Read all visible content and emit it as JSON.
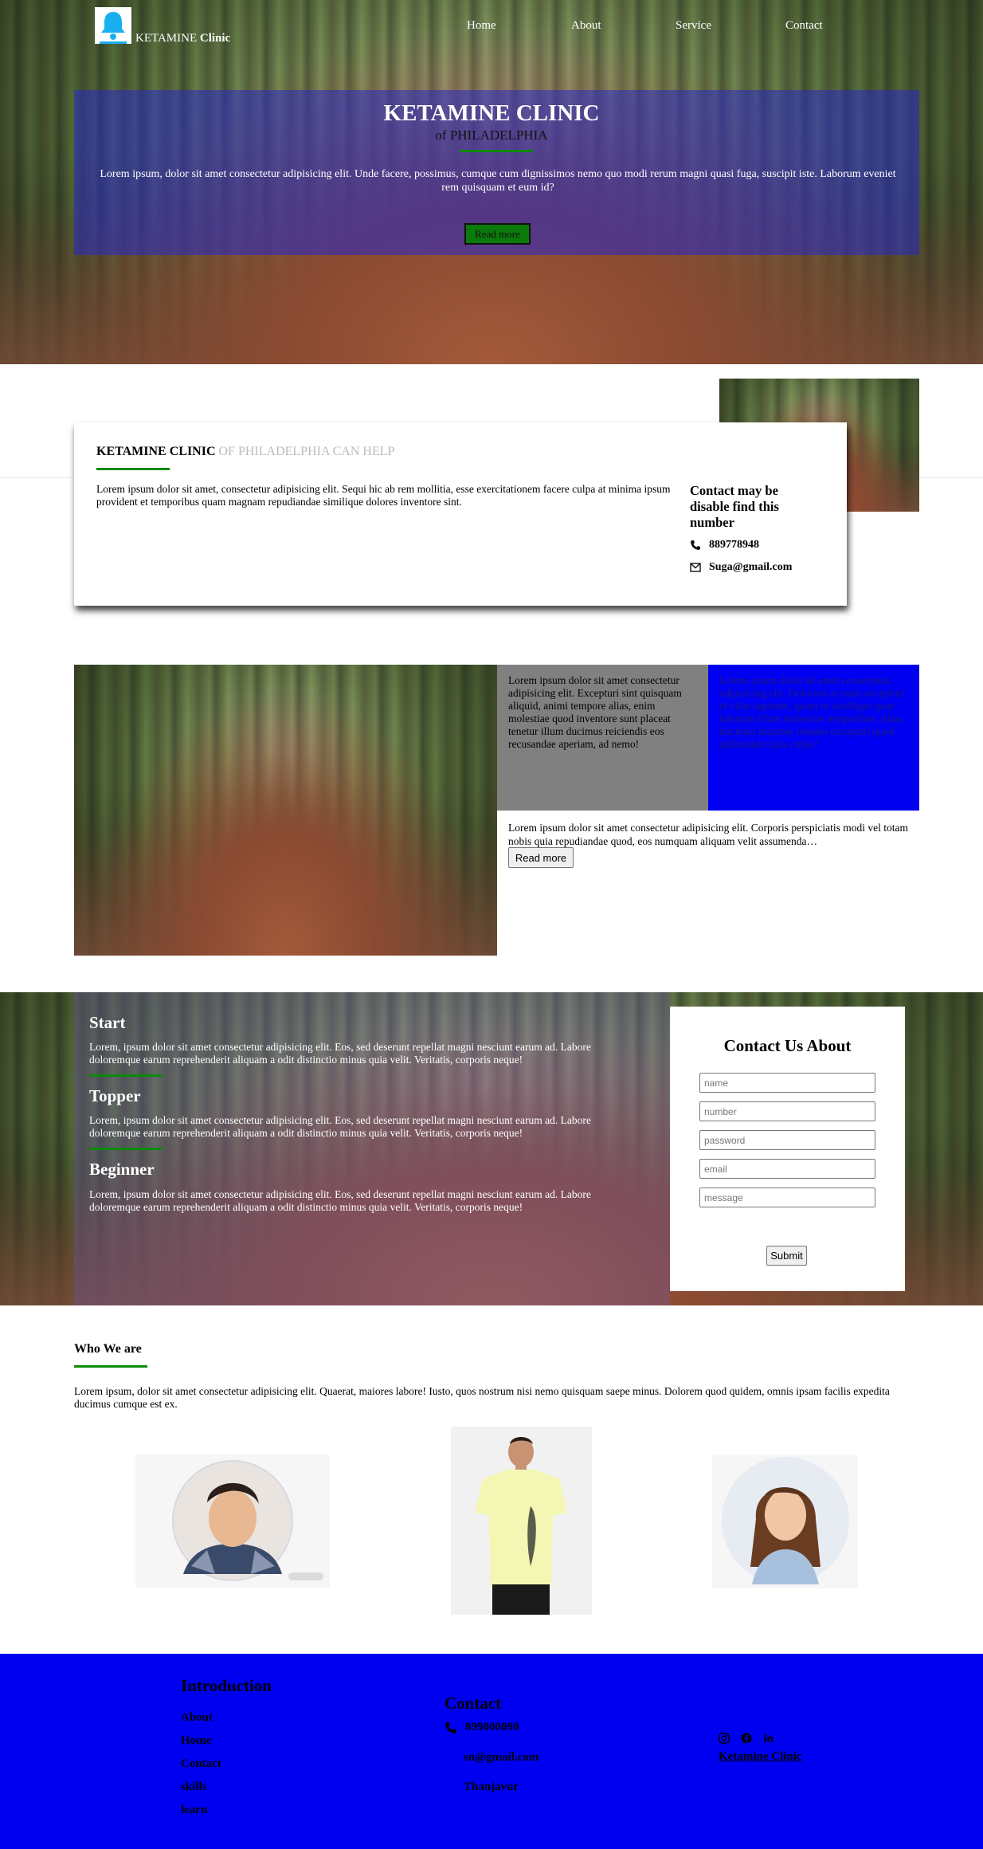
{
  "header": {
    "brand_main": "KETAMINE",
    "brand_bold": "Clinic",
    "nav": [
      "Home",
      "About",
      "Service",
      "Contact"
    ]
  },
  "hero": {
    "title": "KETAMINE CLINIC",
    "subtitle": "of PHILADELPHIA",
    "text": "Lorem ipsum, dolor sit amet consectetur adipisicing elit. Unde facere, possimus, cumque cum dignissimos nemo quo modi rerum magni quasi fuga, suscipit iste. Laborum eveniet rem quisquam et eum id?",
    "button": "Read more"
  },
  "card": {
    "title_bold": "KETAMINE CLINIC",
    "title_light": " OF PHILADELPHIA CAN HELP",
    "text": "Lorem ipsum dolor sit amet, consectetur adipisicing elit. Sequi hic ab rem mollitia, esse exercitationem facere culpa at minima ipsum provident et temporibus quam magnam repudiandae similique dolores inventore sint.",
    "contact_heading": "Contact may be disable find this number",
    "phone": "889778948",
    "email": "Suga@gmail.com"
  },
  "feature": {
    "gray_text": "Lorem ipsum dolor sit amet consectetur adipisicing elit. Excepturi sint quisquam aliquid, animi tempore alias, enim molestiae quod inventore sunt placeat tenetur illum ducimus reiciendis eos recusandae aperiam, ad nemo!",
    "blue_text": "Lorem ipsum dolor sit amet consectetur adipisicing elit. Dolorum at enim excepturi et vitae sapiente, quam ut similique quae laborum illum molestiae temporibus. Alias ducimus maxime veniam excepturi quod quibusdam quia culpa?",
    "text": "Lorem ipsum dolor sit amet consectetur adipisicing elit. Corporis perspiciatis modi vel totam nobis quia repudiandae quod, eos numquam aliquam velit assumenda…",
    "button": "Read more"
  },
  "levels": [
    {
      "title": "Start",
      "text": "Lorem, ipsum dolor sit amet consectetur adipisicing elit. Eos, sed deserunt repellat magni nesciunt earum ad. Labore doloremque earum reprehenderit aliquam a odit distinctio minus quia velit. Veritatis, corporis neque!"
    },
    {
      "title": "Topper",
      "text": "Lorem, ipsum dolor sit amet consectetur adipisicing elit. Eos, sed deserunt repellat magni nesciunt earum ad. Labore doloremque earum reprehenderit aliquam a odit distinctio minus quia velit. Veritatis, corporis neque!"
    },
    {
      "title": "Beginner",
      "text": "Lorem, ipsum dolor sit amet consectetur adipisicing elit. Eos, sed deserunt repellat magni nesciunt earum ad. Labore doloremque earum reprehenderit aliquam a odit distinctio minus quia velit. Veritatis, corporis neque!"
    }
  ],
  "form": {
    "title": "Contact Us About",
    "placeholders": {
      "name": "name",
      "number": "number",
      "password": "password",
      "email": "email",
      "message": "message"
    },
    "submit": "Submit"
  },
  "who": {
    "title": "Who We are",
    "text": "Lorem ipsum, dolor sit amet consectetur adipisicing elit. Quaerat, maiores labore! Iusto, quos nostrum nisi nemo quisquam saepe minus. Dolorem quod quidem, omnis ipsam facilis expedita ducimus cumque est ex."
  },
  "footer": {
    "intro_title": "Introduction",
    "links": [
      "About",
      "Home",
      "Contact",
      "skills",
      "learn"
    ],
    "contact_title": "Contact",
    "phone": "899800090",
    "email": "sn@gmail.com",
    "city": "Thanjavur",
    "brand": "Ketamine Clinic"
  },
  "colors": {
    "accent_green": "#0a8a0a",
    "footer_blue": "#0000f0",
    "hero_overlay": "#2828c8",
    "bell": "#1ab0f0"
  }
}
